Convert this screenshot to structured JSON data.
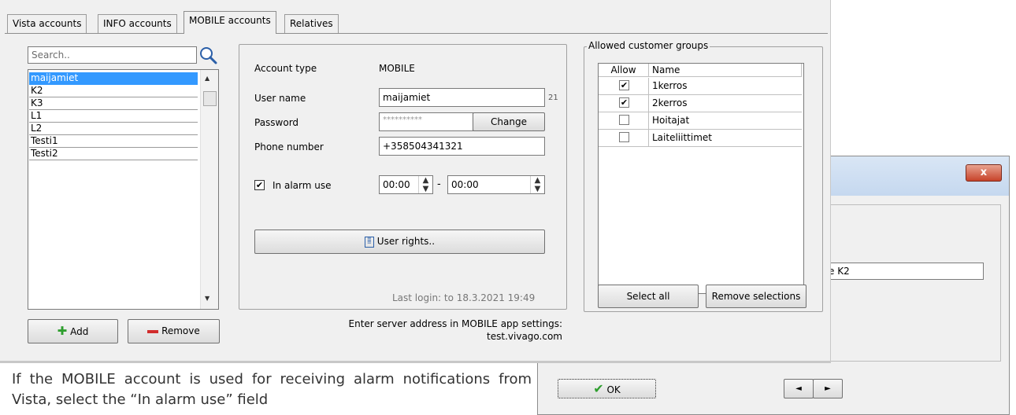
{
  "tabs": [
    {
      "label": "Vista accounts"
    },
    {
      "label": "INFO accounts"
    },
    {
      "label": "MOBILE accounts"
    },
    {
      "label": "Relatives"
    }
  ],
  "search": {
    "placeholder": "Search.."
  },
  "accounts": [
    "maijamiet",
    "K2",
    "K3",
    "L1",
    "L2",
    "Testi1",
    "Testi2"
  ],
  "selected_account": "maijamiet",
  "buttons": {
    "add": "Add",
    "remove": "Remove",
    "change": "Change",
    "user_rights": "User rights..",
    "select_all": "Select all",
    "remove_selections": "Remove selections"
  },
  "account": {
    "type_label": "Account type",
    "type_value": "MOBILE",
    "username_label": "User name",
    "username_value": "maijamiet",
    "username_count": "21",
    "password_label": "Password",
    "password_value": "**********",
    "phone_label": "Phone number",
    "phone_value": "+358504341321",
    "alarm_label": "In alarm use",
    "alarm_checked": true,
    "time_from": "00:00",
    "time_separator": "-",
    "time_to": "00:00",
    "last_login": "Last login: to 18.3.2021 19:49"
  },
  "server_note": {
    "line1": "Enter server address in MOBILE app settings:",
    "line2": "test.vivago.com"
  },
  "groups": {
    "title": "Allowed customer groups",
    "col_allow": "Allow",
    "col_name": "Name",
    "rows": [
      {
        "name": "1kerros",
        "allowed": true
      },
      {
        "name": "2kerros",
        "allowed": true
      },
      {
        "name": "Hoitajat",
        "allowed": false
      },
      {
        "name": "Laiteliittimet",
        "allowed": false
      }
    ]
  },
  "dialog": {
    "close_glyph": "x",
    "path_value": "e K2",
    "browse_label": "..",
    "ok_label": "OK",
    "prev_glyph": "◄",
    "next_glyph": "►"
  },
  "caption": "If the MOBILE account is used for receiving alarm notifications from Vista, select the “In alarm use” field"
}
